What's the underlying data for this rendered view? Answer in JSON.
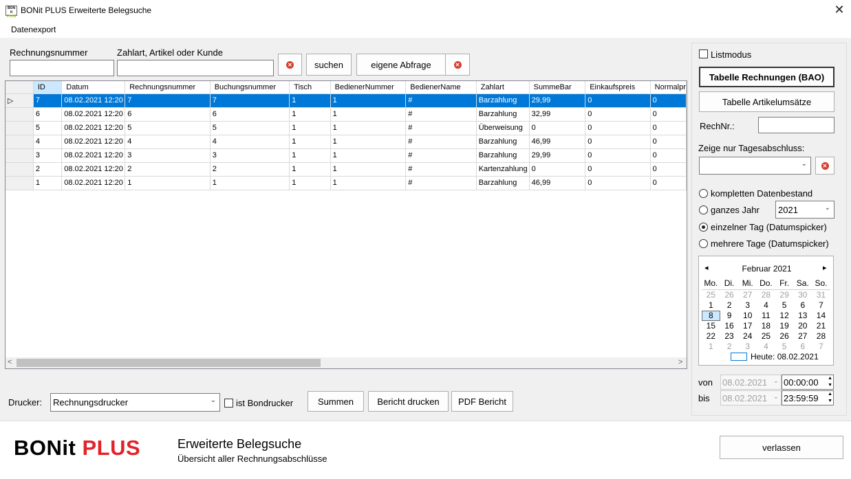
{
  "window": {
    "title": "BONit PLUS Erweiterte Belegsuche",
    "close_glyph": "✕",
    "icon_line1": "BON",
    "icon_line2": "it",
    "icon_line3": "PLUS"
  },
  "menu": {
    "items": [
      "Datenexport"
    ]
  },
  "search": {
    "rechnungsnummer_label": "Rechnungsnummer",
    "rechnungsnummer_value": "",
    "zahlart_label": "Zahlart, Artikel oder Kunde",
    "zahlart_value": "",
    "search_button": "suchen",
    "custom_query_button": "eigene Abfrage"
  },
  "grid": {
    "columns": [
      "ID",
      "Datum",
      "Rechnungsnummer",
      "Buchungsnummer",
      "Tisch",
      "BedienerNummer",
      "BedienerName",
      "Zahlart",
      "SummeBar",
      "Einkaufspreis",
      "Normalpr"
    ],
    "rows": [
      [
        "7",
        "08.02.2021 12:20",
        "7",
        "7",
        "1",
        "1",
        "#",
        "Barzahlung",
        "29,99",
        "0",
        "0"
      ],
      [
        "6",
        "08.02.2021 12:20",
        "6",
        "6",
        "1",
        "1",
        "#",
        "Barzahlung",
        "32,99",
        "0",
        "0"
      ],
      [
        "5",
        "08.02.2021 12:20",
        "5",
        "5",
        "1",
        "1",
        "#",
        "Überweisung",
        "0",
        "0",
        "0"
      ],
      [
        "4",
        "08.02.2021 12:20",
        "4",
        "4",
        "1",
        "1",
        "#",
        "Barzahlung",
        "46,99",
        "0",
        "0"
      ],
      [
        "3",
        "08.02.2021 12:20",
        "3",
        "3",
        "1",
        "1",
        "#",
        "Barzahlung",
        "29,99",
        "0",
        "0"
      ],
      [
        "2",
        "08.02.2021 12:20",
        "2",
        "2",
        "1",
        "1",
        "#",
        "Kartenzahlung",
        "0",
        "0",
        "0"
      ],
      [
        "1",
        "08.02.2021 12:20",
        "1",
        "1",
        "1",
        "1",
        "#",
        "Barzahlung",
        "46,99",
        "0",
        "0"
      ]
    ],
    "selected_row_index": 0,
    "sorted_column": "ID",
    "row_indicator": "▷",
    "scroll_left": "<",
    "scroll_right": ">"
  },
  "bottom_bar": {
    "printer_label": "Drucker:",
    "printer_value": "Rechnungsdrucker",
    "bondrucker_label": "ist Bondrucker",
    "bondrucker_checked": false,
    "sum_button": "Summen",
    "print_report_button": "Bericht drucken",
    "pdf_report_button": "PDF Bericht"
  },
  "right_panel": {
    "listmodus_label": "Listmodus",
    "listmodus_checked": false,
    "table_invoices_button": "Tabelle Rechnungen (BAO)",
    "table_articles_button": "Tabelle Artikelumsätze",
    "rechnr_label": "RechNr.:",
    "rechnr_value": "",
    "daily_close_label": "Zeige nur Tagesabschluss:",
    "daily_close_value": "",
    "range_options": [
      {
        "label": "kompletten Datenbestand",
        "checked": false
      },
      {
        "label": "ganzes Jahr",
        "checked": false
      },
      {
        "label": "einzelner Tag (Datumspicker)",
        "checked": true
      },
      {
        "label": "mehrere Tage (Datumspicker)",
        "checked": false
      }
    ],
    "year_value": "2021",
    "calendar": {
      "month_label": "Februar 2021",
      "prev_glyph": "◂",
      "next_glyph": "▸",
      "weekdays": [
        "Mo.",
        "Di.",
        "Mi.",
        "Do.",
        "Fr.",
        "Sa.",
        "So."
      ],
      "weeks": [
        [
          "25",
          "26",
          "27",
          "28",
          "29",
          "30",
          "31"
        ],
        [
          "1",
          "2",
          "3",
          "4",
          "5",
          "6",
          "7"
        ],
        [
          "8",
          "9",
          "10",
          "11",
          "12",
          "13",
          "14"
        ],
        [
          "15",
          "16",
          "17",
          "18",
          "19",
          "20",
          "21"
        ],
        [
          "22",
          "23",
          "24",
          "25",
          "26",
          "27",
          "28"
        ],
        [
          "1",
          "2",
          "3",
          "4",
          "5",
          "6",
          "7"
        ]
      ],
      "muted_weeks": [
        0,
        5
      ],
      "selected_day": "8",
      "today_label": "Heute: 08.02.2021"
    },
    "from_label": "von",
    "to_label": "bis",
    "from_date": "08.02.2021",
    "from_time": "00:00:00",
    "to_date": "08.02.2021",
    "to_time": "23:59:59"
  },
  "footer": {
    "brand_main": "BONit",
    "brand_plus": "PLUS",
    "title": "Erweiterte Belegsuche",
    "subtitle": "Übersicht aller Rechnungsabschlüsse",
    "exit_button": "verlassen"
  },
  "colors": {
    "selection": "#0078d7",
    "brand_plus": "#e3232b",
    "icon_green": "#8bbd2a",
    "clear_red": "#d3402f"
  }
}
